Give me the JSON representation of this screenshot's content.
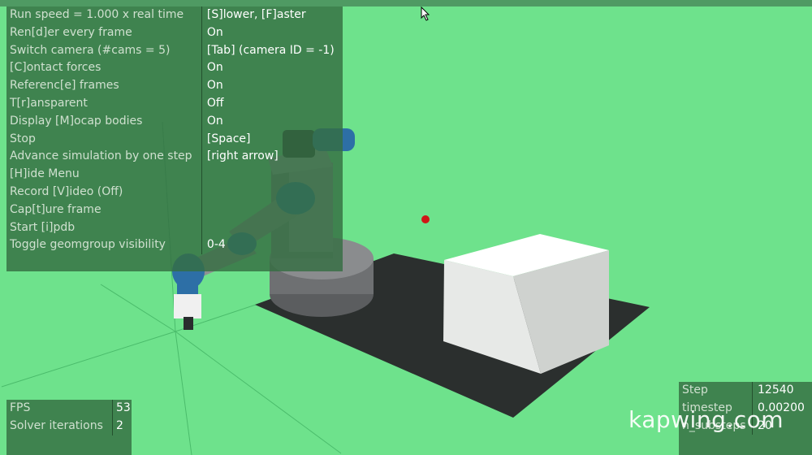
{
  "menu": {
    "rows": [
      {
        "label": "Run speed = 1.000 x real time",
        "value": "[S]lower, [F]aster"
      },
      {
        "label": "Ren[d]er every frame",
        "value": "On"
      },
      {
        "label": "Switch camera (#cams = 5)",
        "value": "[Tab] (camera ID = -1)"
      },
      {
        "label": "[C]ontact forces",
        "value": "On"
      },
      {
        "label": "Referenc[e] frames",
        "value": "On"
      },
      {
        "label": "T[r]ansparent",
        "value": "Off"
      },
      {
        "label": "Display [M]ocap bodies",
        "value": "On"
      },
      {
        "label": "Stop",
        "value": "[Space]"
      },
      {
        "label": "Advance simulation by one step",
        "value": "[right arrow]"
      },
      {
        "label": "[H]ide Menu",
        "value": ""
      },
      {
        "label": "Record [V]ideo (Off)",
        "value": ""
      },
      {
        "label": "Cap[t]ure frame",
        "value": ""
      },
      {
        "label": "Start [i]pdb",
        "value": ""
      },
      {
        "label": "Toggle geomgroup visibility",
        "value": "0-4"
      }
    ]
  },
  "perf": {
    "rows": [
      {
        "label": "FPS",
        "value": "53"
      },
      {
        "label": "Solver iterations",
        "value": "2"
      }
    ]
  },
  "stats": {
    "rows": [
      {
        "label": "Step",
        "value": "12540"
      },
      {
        "label": "timestep",
        "value": "0.00200"
      },
      {
        "label": "n_substeps",
        "value": "20"
      }
    ]
  },
  "watermark": "kapwing.com",
  "colors": {
    "background": "#6ee28c",
    "panel": "#346e42",
    "robot_blue": "#2d6fa6",
    "robot_gray": "#7a7c7e",
    "floor": "#2b2f2e",
    "box": "#f1f3f1",
    "target": "#d01616"
  }
}
